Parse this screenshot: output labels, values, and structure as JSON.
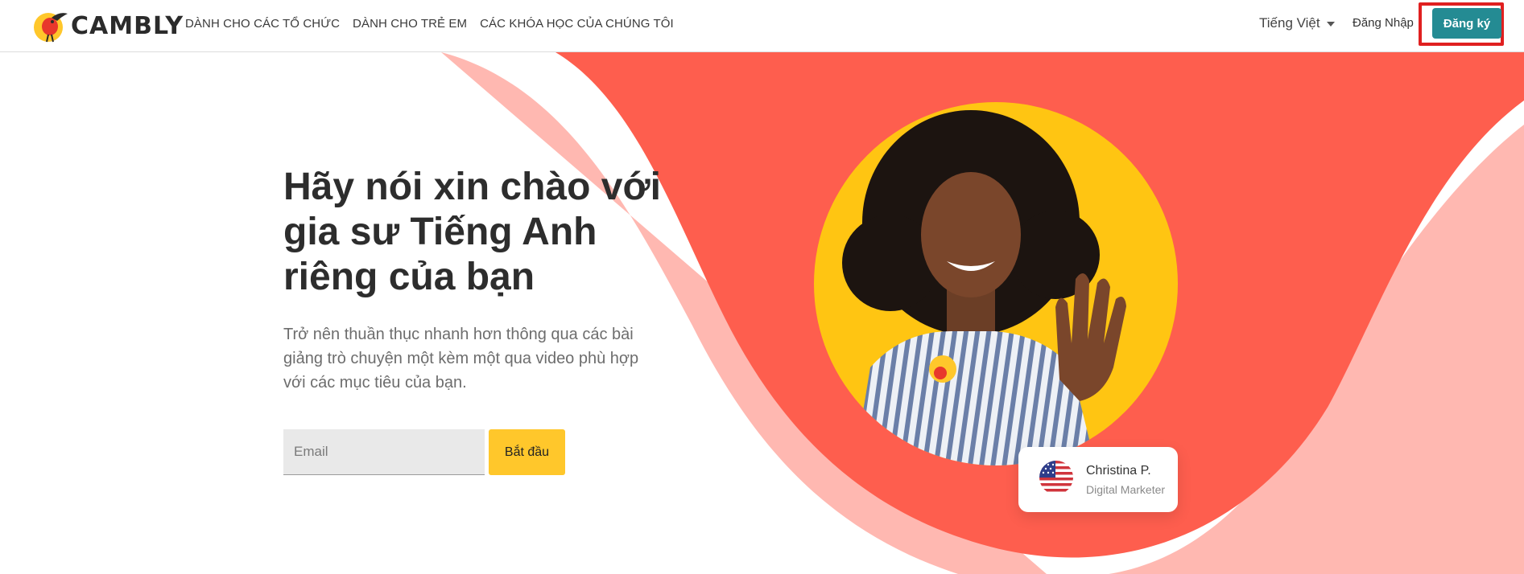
{
  "brand": {
    "name": "CAMBLY"
  },
  "nav": {
    "items": [
      {
        "label": "DÀNH CHO CÁC TỔ CHỨC"
      },
      {
        "label": "DÀNH CHO TRẺ EM"
      },
      {
        "label": "CÁC KHÓA HỌC CỦA CHÚNG TÔI"
      }
    ],
    "language": "Tiếng Việt",
    "login": "Đăng Nhập",
    "signup": "Đăng ký"
  },
  "hero": {
    "headline": "Hãy nói xin chào với gia sư Tiếng Anh riêng của bạn",
    "subtext": "Trở nên thuần thục nhanh hơn thông qua các bài giảng trò chuyện một kèm một qua video phù hợp với các mục tiêu của bạn.",
    "email_placeholder": "Email",
    "cta": "Bắt đầu"
  },
  "tutor": {
    "name": "Christina P.",
    "role": "Digital Marketer"
  },
  "colors": {
    "coral": "#fe5e4e",
    "pink": "#ffb8b1",
    "teal_button": "#248b93",
    "yellow": "#ffc72b",
    "highlight_frame": "#e02020"
  }
}
